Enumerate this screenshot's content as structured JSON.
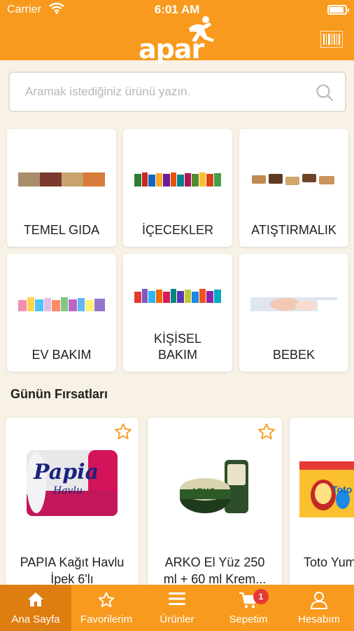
{
  "status_bar": {
    "carrier": "Carrier",
    "time": "6:01 AM"
  },
  "header": {
    "logo_text": "apar"
  },
  "search": {
    "placeholder": "Aramak istediğiniz ürünü yazın."
  },
  "categories": [
    {
      "label": "TEMEL GIDA"
    },
    {
      "label": "İÇECEKLER"
    },
    {
      "label": "ATIŞTIRMALIK"
    },
    {
      "label": "EV BAKIM"
    },
    {
      "label_line1": "KİŞİSEL",
      "label_line2": "BAKIM"
    },
    {
      "label": "BEBEK"
    }
  ],
  "deals": {
    "title": "Günün Fırsatları",
    "products": [
      {
        "name_line1": "PAPIA Kağıt Havlu",
        "name_line2": "İpek 6'lı",
        "brand": "Papia",
        "sub": "Havlu"
      },
      {
        "name_line1": "ARKO El Yüz 250",
        "name_line2": "ml + 60 ml Krem...",
        "brand": "ARKO"
      },
      {
        "name_line1": "Toto Yum",
        "brand": "Toto"
      }
    ]
  },
  "tabbar": {
    "tabs": [
      {
        "label": "Ana Sayfa"
      },
      {
        "label": "Favorilerim"
      },
      {
        "label": "Ürünler"
      },
      {
        "label": "Sepetim",
        "badge": "1"
      },
      {
        "label": "Hesabım"
      }
    ]
  },
  "colors": {
    "brand_orange": "#f79a1e",
    "active_tab": "#de7d10",
    "background": "#f7f1e6",
    "badge_red": "#e53935"
  }
}
